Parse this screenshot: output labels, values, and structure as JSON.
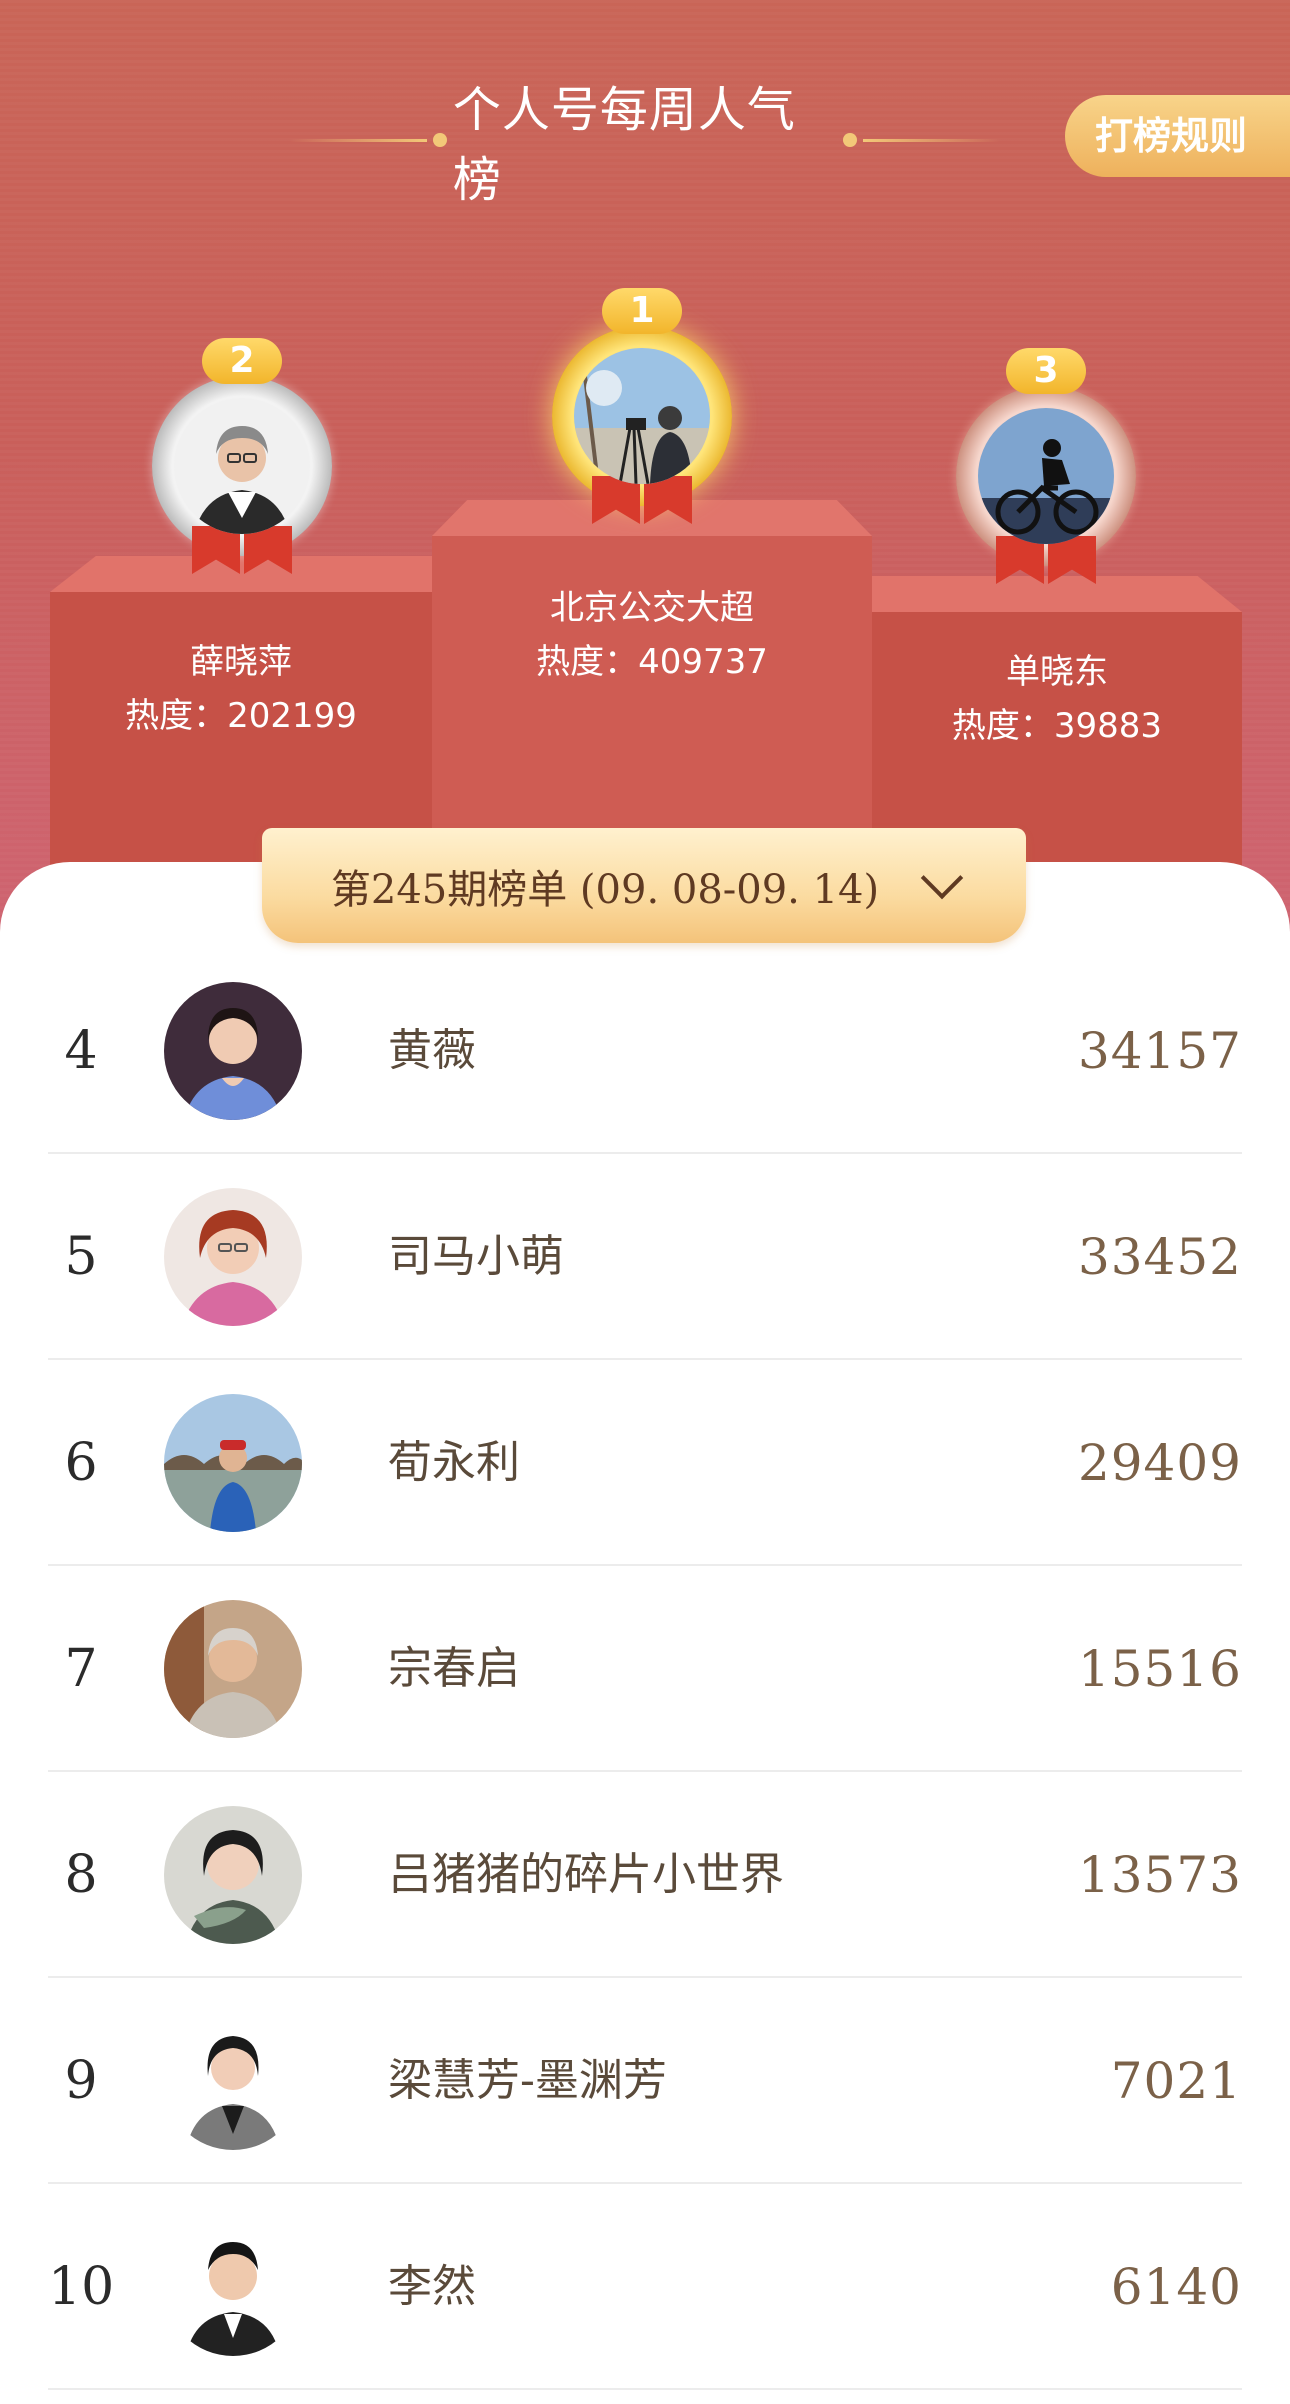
{
  "header": {
    "title": "个人号每周人气榜",
    "rules_button": "打榜规则"
  },
  "podium": [
    {
      "rank": "1",
      "name": "北京公交大超",
      "heat_label": "热度：",
      "heat_value": "409737",
      "avatar_icon": "photographer-avatar"
    },
    {
      "rank": "2",
      "name": "薛晓萍",
      "heat_label": "热度：",
      "heat_value": "202199",
      "avatar_icon": "woman-avatar"
    },
    {
      "rank": "3",
      "name": "单晓东",
      "heat_label": "热度：",
      "heat_value": "39883",
      "avatar_icon": "cyclist-avatar"
    }
  ],
  "period": {
    "label": "第245期榜单 (09. 08-09. 14)"
  },
  "list": [
    {
      "rank": "4",
      "name": "黄薇",
      "score": "34157"
    },
    {
      "rank": "5",
      "name": "司马小萌",
      "score": "33452"
    },
    {
      "rank": "6",
      "name": "荀永利",
      "score": "29409"
    },
    {
      "rank": "7",
      "name": "宗春启",
      "score": "15516"
    },
    {
      "rank": "8",
      "name": "吕猪猪的碎片小世界",
      "score": "13573"
    },
    {
      "rank": "9",
      "name": "梁慧芳-墨渊芳",
      "score": "7021"
    },
    {
      "rank": "10",
      "name": "李然",
      "score": "6140"
    }
  ],
  "colors": {
    "hero_bg": "#c96557",
    "podium_face": "#c65147",
    "gold": "#f2c878",
    "list_text": "#5a4a3a",
    "score_text": "#7b6148"
  }
}
